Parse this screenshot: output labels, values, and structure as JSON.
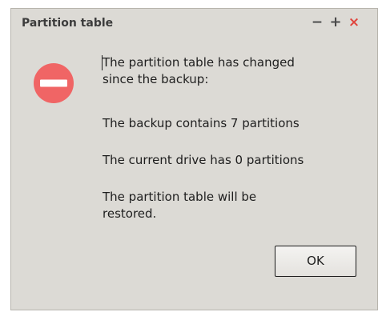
{
  "window": {
    "title": "Partition table",
    "controls": {
      "minimize": "−",
      "maximize": "+",
      "close": "×"
    }
  },
  "icon": "error-stop-icon",
  "message": {
    "line1": "The partition table has changed",
    "line1b": "since the backup:",
    "line2": "The backup contains 7 partitions",
    "line3": "The current drive has 0 partitions",
    "line4": "The partition table will be",
    "line4b": "restored."
  },
  "buttons": {
    "ok_label": "OK"
  },
  "colors": {
    "icon": "#f06565",
    "close": "#e0453d",
    "background": "#dcdad5"
  }
}
